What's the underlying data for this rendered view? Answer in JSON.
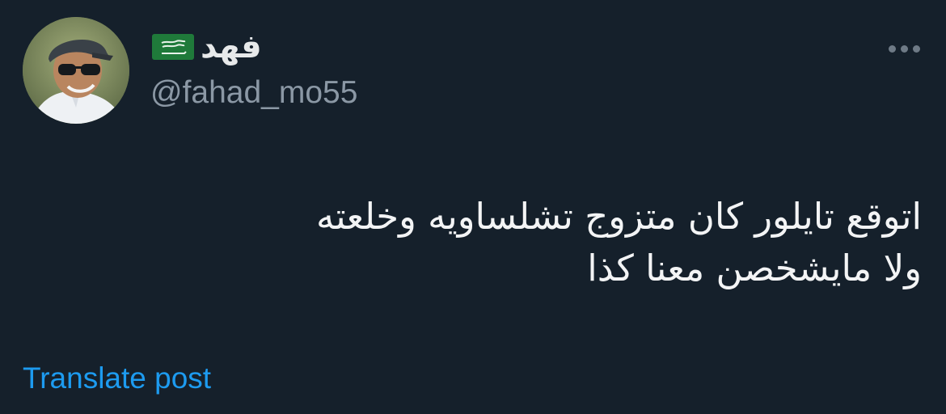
{
  "user": {
    "display_name": "فهد",
    "handle": "@fahad_mo55",
    "flag_icon": "saudi-arabia-flag-icon",
    "avatar_icon": "user-avatar-photo"
  },
  "post": {
    "text_lines": [
      "اتوقع تايلور كان متزوج تشلساويه وخلعته",
      "ولا مايشخصن معنا كذا"
    ]
  },
  "actions": {
    "translate_label": "Translate post",
    "more_icon": "more-options-icon"
  },
  "colors": {
    "background": "#15202b",
    "primary_text": "#e7e9ea",
    "secondary_text": "#8b98a5",
    "link": "#1d9bf0",
    "flag_green": "#1f7a3a"
  }
}
